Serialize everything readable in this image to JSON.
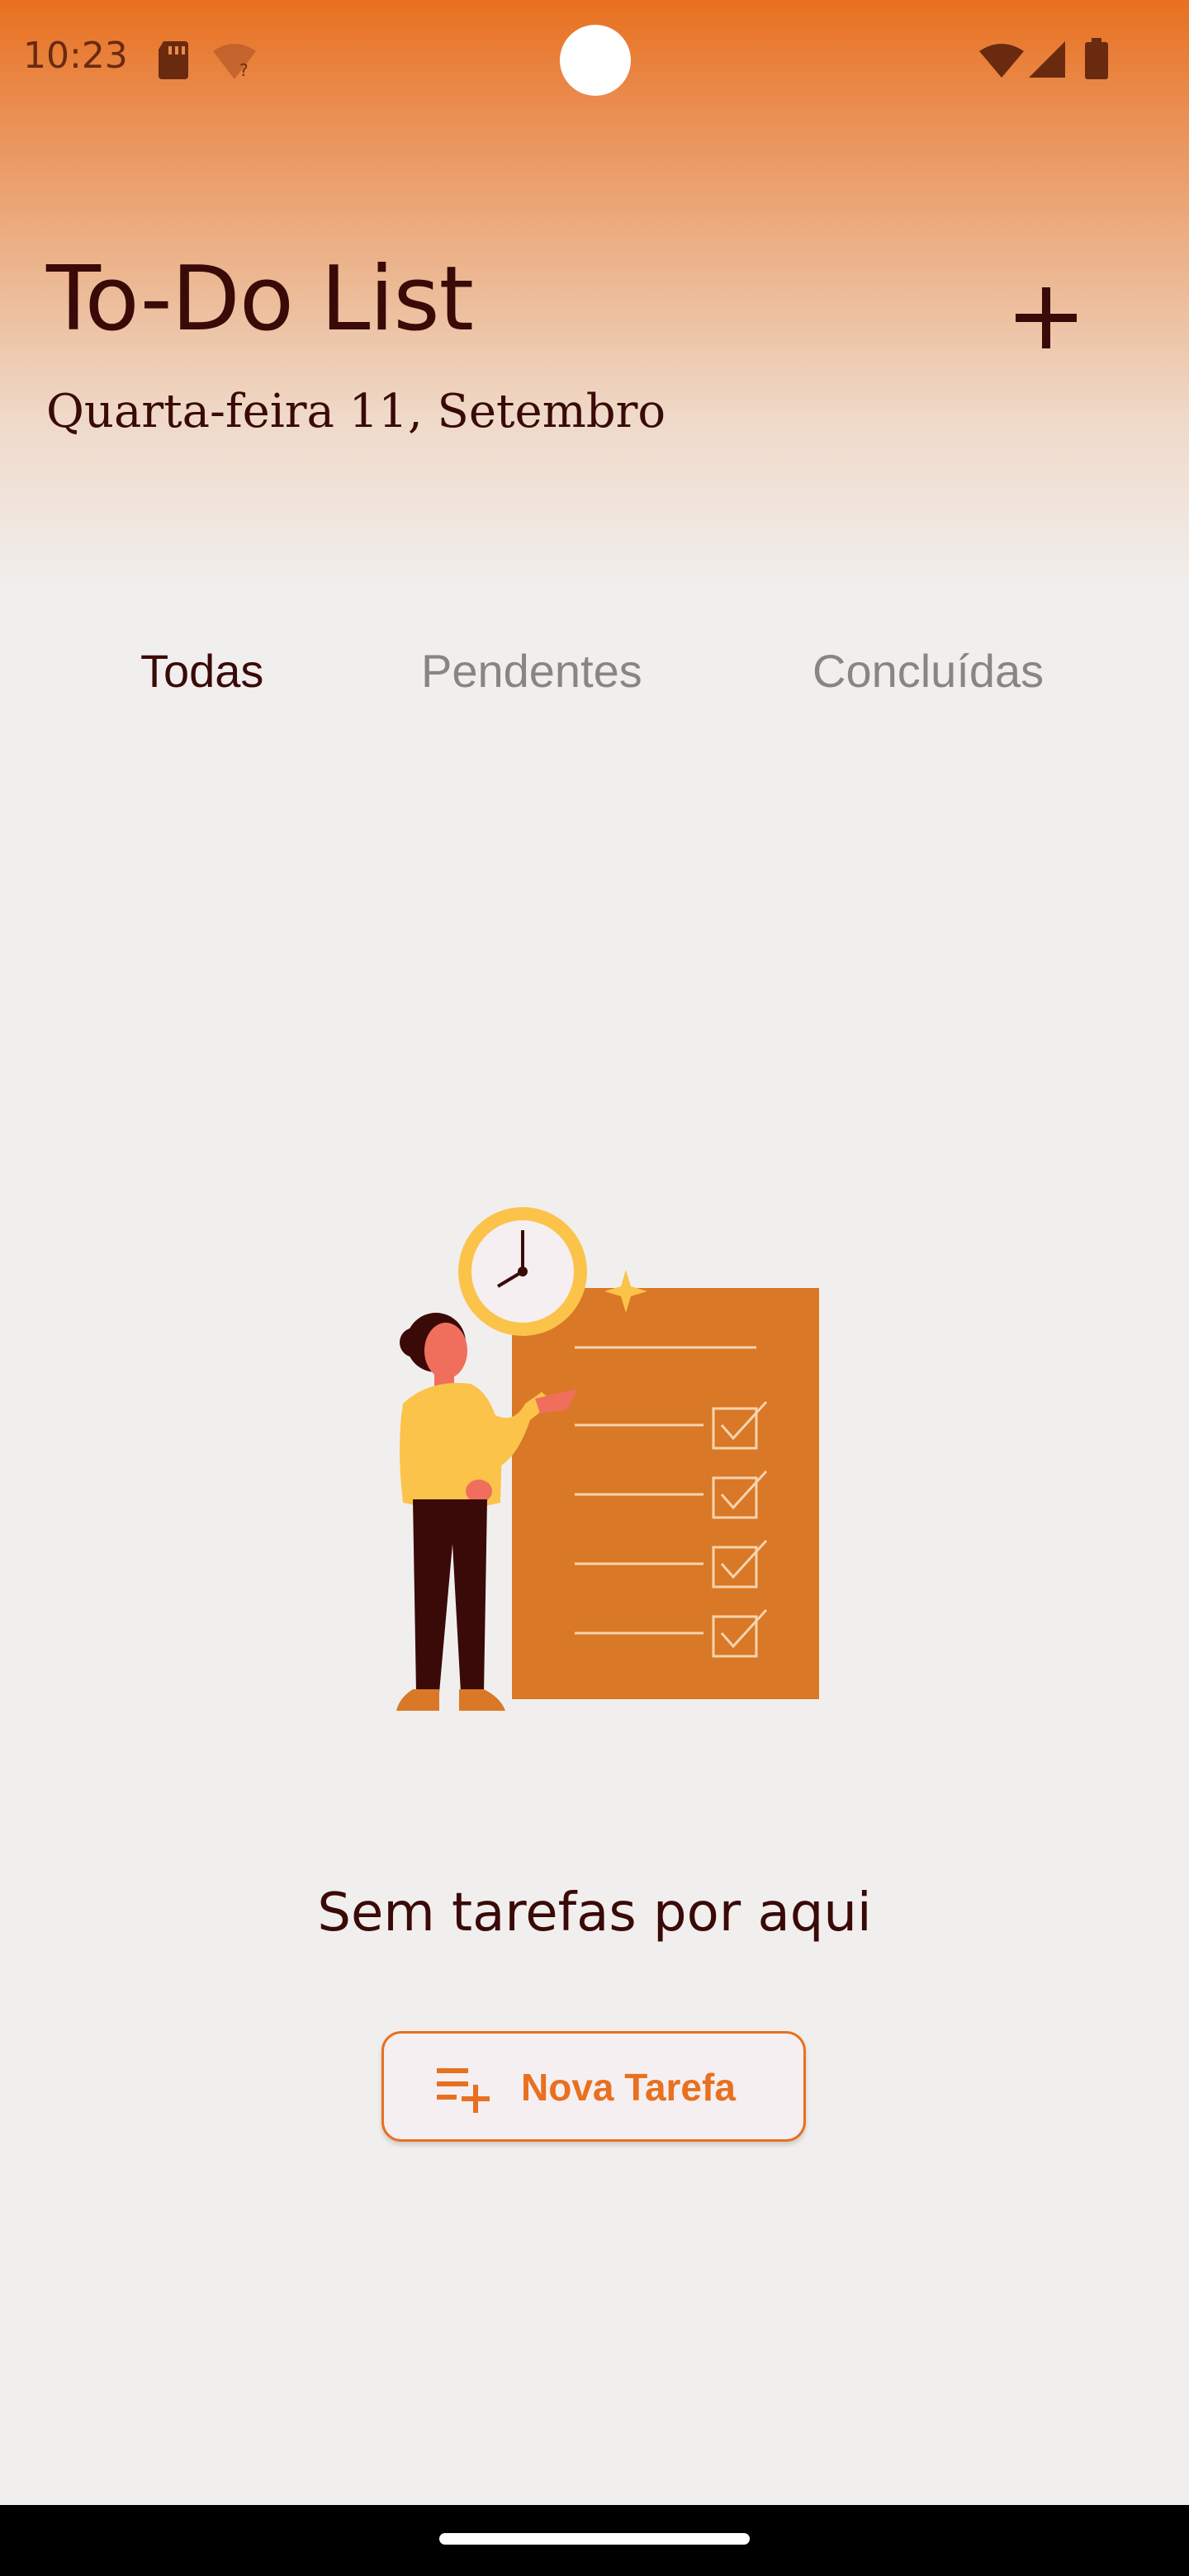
{
  "status_bar": {
    "time": "10:23",
    "icons": [
      "sd-card-icon",
      "wifi-question-icon",
      "wifi-icon",
      "signal-icon",
      "battery-icon"
    ]
  },
  "header": {
    "title": "To-Do List",
    "date": "Quarta-feira 11, Setembro",
    "add_icon": "plus-icon"
  },
  "tabs": [
    {
      "label": "Todas",
      "active": true
    },
    {
      "label": "Pendentes",
      "active": false
    },
    {
      "label": "Concluídas",
      "active": false
    }
  ],
  "empty_state": {
    "illustration": "checklist-illustration",
    "message": "Sem tarefas por aqui",
    "button_label": "Nova Tarefa",
    "button_icon": "playlist-add-icon"
  },
  "colors": {
    "accent": "#e8701f",
    "text_dark": "#3a0a08",
    "tab_inactive": "#8a8583",
    "background": "#f1efee",
    "board": "#d97826",
    "shirt": "#fbc34a"
  }
}
